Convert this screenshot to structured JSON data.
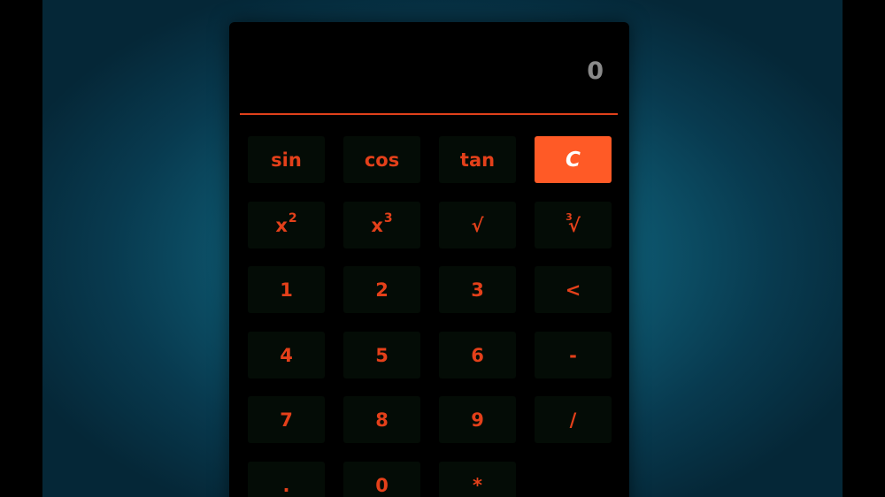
{
  "display": {
    "value": "0"
  },
  "colors": {
    "accent": "#e4401a",
    "clear_button_bg": "#ff5a26",
    "key_bg": "#040c06",
    "background": "#137089"
  },
  "keys": {
    "sin": "sin",
    "cos": "cos",
    "tan": "tan",
    "clear": "C",
    "square_base": "x",
    "square_exp": "2",
    "cube_base": "x",
    "cube_exp": "3",
    "sqrt": "√",
    "cbrt_index": "3",
    "cbrt_radical": "√",
    "one": "1",
    "two": "2",
    "three": "3",
    "backspace": "<",
    "four": "4",
    "five": "5",
    "six": "6",
    "minus": "-",
    "seven": "7",
    "eight": "8",
    "nine": "9",
    "divide": "/",
    "dot": ".",
    "zero": "0",
    "multiply": "*"
  }
}
